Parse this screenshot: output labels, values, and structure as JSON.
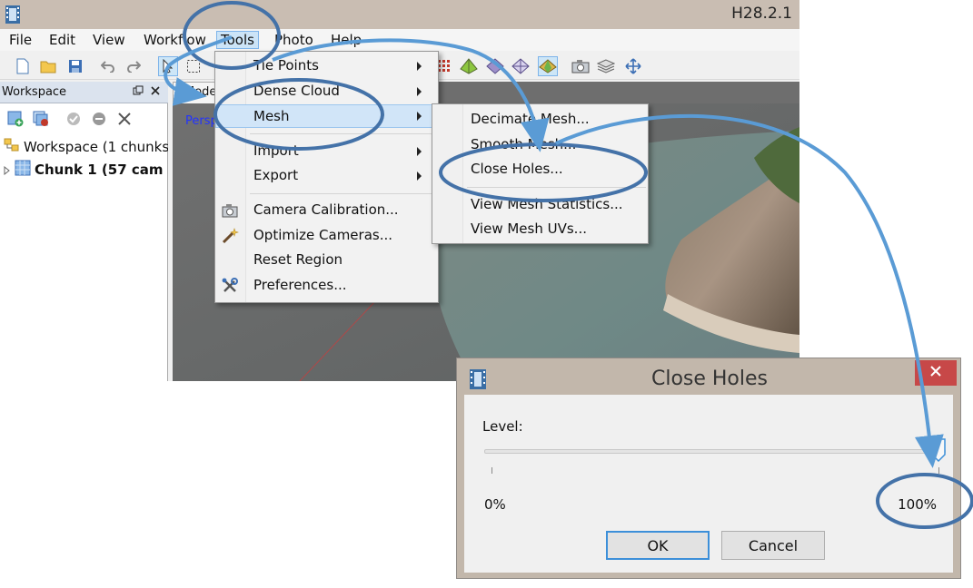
{
  "window": {
    "title": "H28.2.1"
  },
  "menubar": {
    "items": [
      "File",
      "Edit",
      "View",
      "Workflow",
      "Tools",
      "Photo",
      "Help"
    ],
    "active": "Tools"
  },
  "workspace_panel": {
    "title": "Workspace",
    "tree": [
      {
        "label": "Workspace (1 chunks",
        "bold": false
      },
      {
        "label": "Chunk 1 (57 cam",
        "bold": true
      }
    ]
  },
  "model_view": {
    "tab": "Model",
    "view_label": "Persp"
  },
  "tools_menu": {
    "items": [
      {
        "label": "Tie Points",
        "submenu": true
      },
      {
        "label": "Dense Cloud",
        "submenu": true
      },
      {
        "label": "Mesh",
        "submenu": true,
        "highlighted": true
      },
      {
        "label": "Import",
        "submenu": true
      },
      {
        "label": "Export",
        "submenu": true
      },
      {
        "label": "Camera Calibration...",
        "icon": "camera-icon"
      },
      {
        "label": "Optimize Cameras...",
        "icon": "wand-icon"
      },
      {
        "label": "Reset Region"
      },
      {
        "label": "Preferences...",
        "icon": "tools-icon"
      }
    ]
  },
  "mesh_submenu": {
    "items": [
      "Decimate Mesh...",
      "Smooth Mesh...",
      "Close Holes...",
      "View Mesh Statistics...",
      "View Mesh UVs..."
    ]
  },
  "dialog": {
    "title": "Close Holes",
    "level_label": "Level:",
    "min_label": "0%",
    "max_label": "100%",
    "level_percent": 100,
    "ok_label": "OK",
    "cancel_label": "Cancel"
  },
  "colors": {
    "annotation": "#5a9bd5",
    "title_bar": "#c9bdb2",
    "highlight": "#d1e5f8",
    "close_button": "#c74848"
  }
}
